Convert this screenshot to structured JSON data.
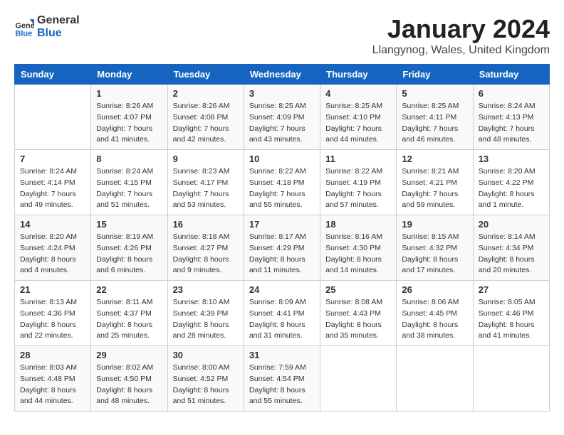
{
  "logo": {
    "general": "General",
    "blue": "Blue"
  },
  "title": "January 2024",
  "subtitle": "Llangynog, Wales, United Kingdom",
  "days_of_week": [
    "Sunday",
    "Monday",
    "Tuesday",
    "Wednesday",
    "Thursday",
    "Friday",
    "Saturday"
  ],
  "weeks": [
    [
      {
        "day": "",
        "sunrise": "",
        "sunset": "",
        "daylight": ""
      },
      {
        "day": "1",
        "sunrise": "Sunrise: 8:26 AM",
        "sunset": "Sunset: 4:07 PM",
        "daylight": "Daylight: 7 hours and 41 minutes."
      },
      {
        "day": "2",
        "sunrise": "Sunrise: 8:26 AM",
        "sunset": "Sunset: 4:08 PM",
        "daylight": "Daylight: 7 hours and 42 minutes."
      },
      {
        "day": "3",
        "sunrise": "Sunrise: 8:25 AM",
        "sunset": "Sunset: 4:09 PM",
        "daylight": "Daylight: 7 hours and 43 minutes."
      },
      {
        "day": "4",
        "sunrise": "Sunrise: 8:25 AM",
        "sunset": "Sunset: 4:10 PM",
        "daylight": "Daylight: 7 hours and 44 minutes."
      },
      {
        "day": "5",
        "sunrise": "Sunrise: 8:25 AM",
        "sunset": "Sunset: 4:11 PM",
        "daylight": "Daylight: 7 hours and 46 minutes."
      },
      {
        "day": "6",
        "sunrise": "Sunrise: 8:24 AM",
        "sunset": "Sunset: 4:13 PM",
        "daylight": "Daylight: 7 hours and 48 minutes."
      }
    ],
    [
      {
        "day": "7",
        "sunrise": "Sunrise: 8:24 AM",
        "sunset": "Sunset: 4:14 PM",
        "daylight": "Daylight: 7 hours and 49 minutes."
      },
      {
        "day": "8",
        "sunrise": "Sunrise: 8:24 AM",
        "sunset": "Sunset: 4:15 PM",
        "daylight": "Daylight: 7 hours and 51 minutes."
      },
      {
        "day": "9",
        "sunrise": "Sunrise: 8:23 AM",
        "sunset": "Sunset: 4:17 PM",
        "daylight": "Daylight: 7 hours and 53 minutes."
      },
      {
        "day": "10",
        "sunrise": "Sunrise: 8:22 AM",
        "sunset": "Sunset: 4:18 PM",
        "daylight": "Daylight: 7 hours and 55 minutes."
      },
      {
        "day": "11",
        "sunrise": "Sunrise: 8:22 AM",
        "sunset": "Sunset: 4:19 PM",
        "daylight": "Daylight: 7 hours and 57 minutes."
      },
      {
        "day": "12",
        "sunrise": "Sunrise: 8:21 AM",
        "sunset": "Sunset: 4:21 PM",
        "daylight": "Daylight: 7 hours and 59 minutes."
      },
      {
        "day": "13",
        "sunrise": "Sunrise: 8:20 AM",
        "sunset": "Sunset: 4:22 PM",
        "daylight": "Daylight: 8 hours and 1 minute."
      }
    ],
    [
      {
        "day": "14",
        "sunrise": "Sunrise: 8:20 AM",
        "sunset": "Sunset: 4:24 PM",
        "daylight": "Daylight: 8 hours and 4 minutes."
      },
      {
        "day": "15",
        "sunrise": "Sunrise: 8:19 AM",
        "sunset": "Sunset: 4:26 PM",
        "daylight": "Daylight: 8 hours and 6 minutes."
      },
      {
        "day": "16",
        "sunrise": "Sunrise: 8:18 AM",
        "sunset": "Sunset: 4:27 PM",
        "daylight": "Daylight: 8 hours and 9 minutes."
      },
      {
        "day": "17",
        "sunrise": "Sunrise: 8:17 AM",
        "sunset": "Sunset: 4:29 PM",
        "daylight": "Daylight: 8 hours and 11 minutes."
      },
      {
        "day": "18",
        "sunrise": "Sunrise: 8:16 AM",
        "sunset": "Sunset: 4:30 PM",
        "daylight": "Daylight: 8 hours and 14 minutes."
      },
      {
        "day": "19",
        "sunrise": "Sunrise: 8:15 AM",
        "sunset": "Sunset: 4:32 PM",
        "daylight": "Daylight: 8 hours and 17 minutes."
      },
      {
        "day": "20",
        "sunrise": "Sunrise: 8:14 AM",
        "sunset": "Sunset: 4:34 PM",
        "daylight": "Daylight: 8 hours and 20 minutes."
      }
    ],
    [
      {
        "day": "21",
        "sunrise": "Sunrise: 8:13 AM",
        "sunset": "Sunset: 4:36 PM",
        "daylight": "Daylight: 8 hours and 22 minutes."
      },
      {
        "day": "22",
        "sunrise": "Sunrise: 8:11 AM",
        "sunset": "Sunset: 4:37 PM",
        "daylight": "Daylight: 8 hours and 25 minutes."
      },
      {
        "day": "23",
        "sunrise": "Sunrise: 8:10 AM",
        "sunset": "Sunset: 4:39 PM",
        "daylight": "Daylight: 8 hours and 28 minutes."
      },
      {
        "day": "24",
        "sunrise": "Sunrise: 8:09 AM",
        "sunset": "Sunset: 4:41 PM",
        "daylight": "Daylight: 8 hours and 31 minutes."
      },
      {
        "day": "25",
        "sunrise": "Sunrise: 8:08 AM",
        "sunset": "Sunset: 4:43 PM",
        "daylight": "Daylight: 8 hours and 35 minutes."
      },
      {
        "day": "26",
        "sunrise": "Sunrise: 8:06 AM",
        "sunset": "Sunset: 4:45 PM",
        "daylight": "Daylight: 8 hours and 38 minutes."
      },
      {
        "day": "27",
        "sunrise": "Sunrise: 8:05 AM",
        "sunset": "Sunset: 4:46 PM",
        "daylight": "Daylight: 8 hours and 41 minutes."
      }
    ],
    [
      {
        "day": "28",
        "sunrise": "Sunrise: 8:03 AM",
        "sunset": "Sunset: 4:48 PM",
        "daylight": "Daylight: 8 hours and 44 minutes."
      },
      {
        "day": "29",
        "sunrise": "Sunrise: 8:02 AM",
        "sunset": "Sunset: 4:50 PM",
        "daylight": "Daylight: 8 hours and 48 minutes."
      },
      {
        "day": "30",
        "sunrise": "Sunrise: 8:00 AM",
        "sunset": "Sunset: 4:52 PM",
        "daylight": "Daylight: 8 hours and 51 minutes."
      },
      {
        "day": "31",
        "sunrise": "Sunrise: 7:59 AM",
        "sunset": "Sunset: 4:54 PM",
        "daylight": "Daylight: 8 hours and 55 minutes."
      },
      {
        "day": "",
        "sunrise": "",
        "sunset": "",
        "daylight": ""
      },
      {
        "day": "",
        "sunrise": "",
        "sunset": "",
        "daylight": ""
      },
      {
        "day": "",
        "sunrise": "",
        "sunset": "",
        "daylight": ""
      }
    ]
  ]
}
